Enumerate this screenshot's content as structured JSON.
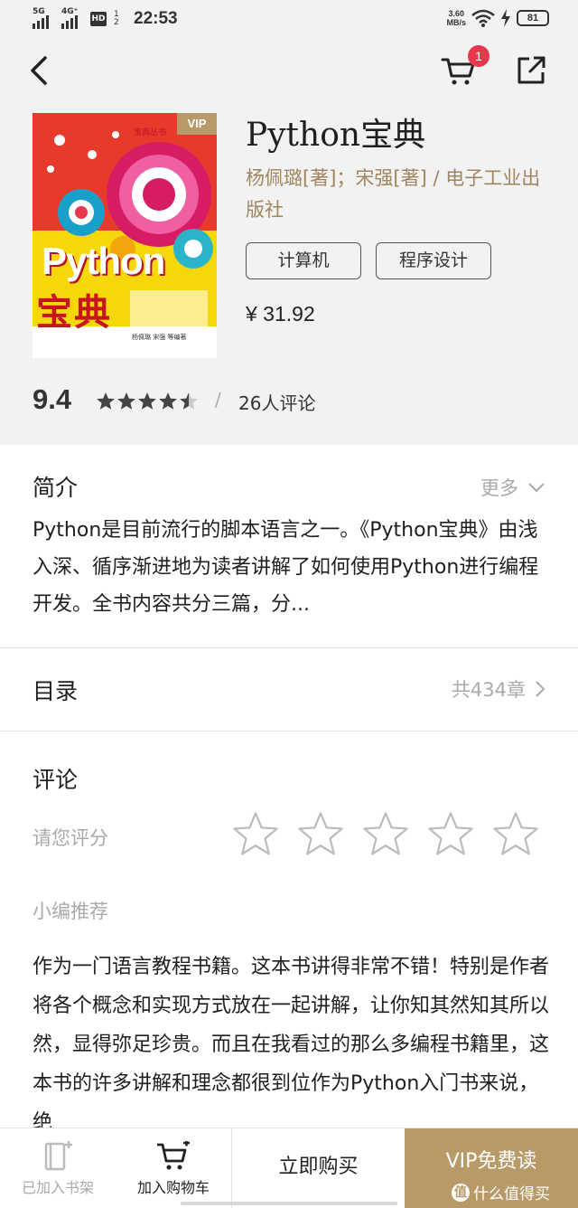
{
  "status_bar": {
    "network_1": "5G",
    "network_2": "4G⁺",
    "hd_label": "HD",
    "hd_sub_1": "1",
    "hd_sub_2": "2",
    "time": "22:53",
    "speed_value": "3.60",
    "speed_unit": "MB/s",
    "battery": "81"
  },
  "header": {
    "cart_badge": "1"
  },
  "book": {
    "cover": {
      "vip_badge": "VIP",
      "series": "宝典丛书",
      "title": "Python",
      "title_cn": "宝典",
      "footer": "杨佩璐 宋强 等编著"
    },
    "title": "Python宝典",
    "authors": "杨佩璐[著]；宋强[著]  /  电子工业出版社",
    "tags": [
      "计算机",
      "程序设计"
    ],
    "price": "¥ 31.92",
    "rating_score": "9.4",
    "rating_stars": 4.5,
    "rating_separator": "/",
    "review_count": "26人评论"
  },
  "intro": {
    "heading": "简介",
    "more_label": "更多",
    "text": "Python是目前流行的脚本语言之一。《Python宝典》由浅入深、循序渐进地为读者讲解了如何使用Python进行编程开发。全书内容共分三篇，分..."
  },
  "toc": {
    "heading": "目录",
    "count_label": "共434章"
  },
  "comments": {
    "heading": "评论",
    "rate_prompt": "请您评分",
    "user_rating": 0,
    "editor_label": "小编推荐",
    "editor_text": "作为一门语言教程书籍。这本书讲得非常不错！特别是作者将各个概念和实现方式放在一起讲解，让你知其然知其所以然，显得弥足珍贵。而且在我看过的那么多编程书籍里，这本书的许多讲解和理念都很到位作为Python入门书来说，绝"
  },
  "bottom_bar": {
    "shelf_label": "已加入书架",
    "cart_label": "加入购物车",
    "buy_label": "立即购买",
    "vip_label": "VIP免费读"
  },
  "watermark": {
    "text": "什么值得买",
    "icon_glyph": "值"
  },
  "colors": {
    "accent_gold": "#b89a68",
    "author_text": "#a08560",
    "badge_red": "#e8384d",
    "header_bg": "#f2f2f2"
  }
}
